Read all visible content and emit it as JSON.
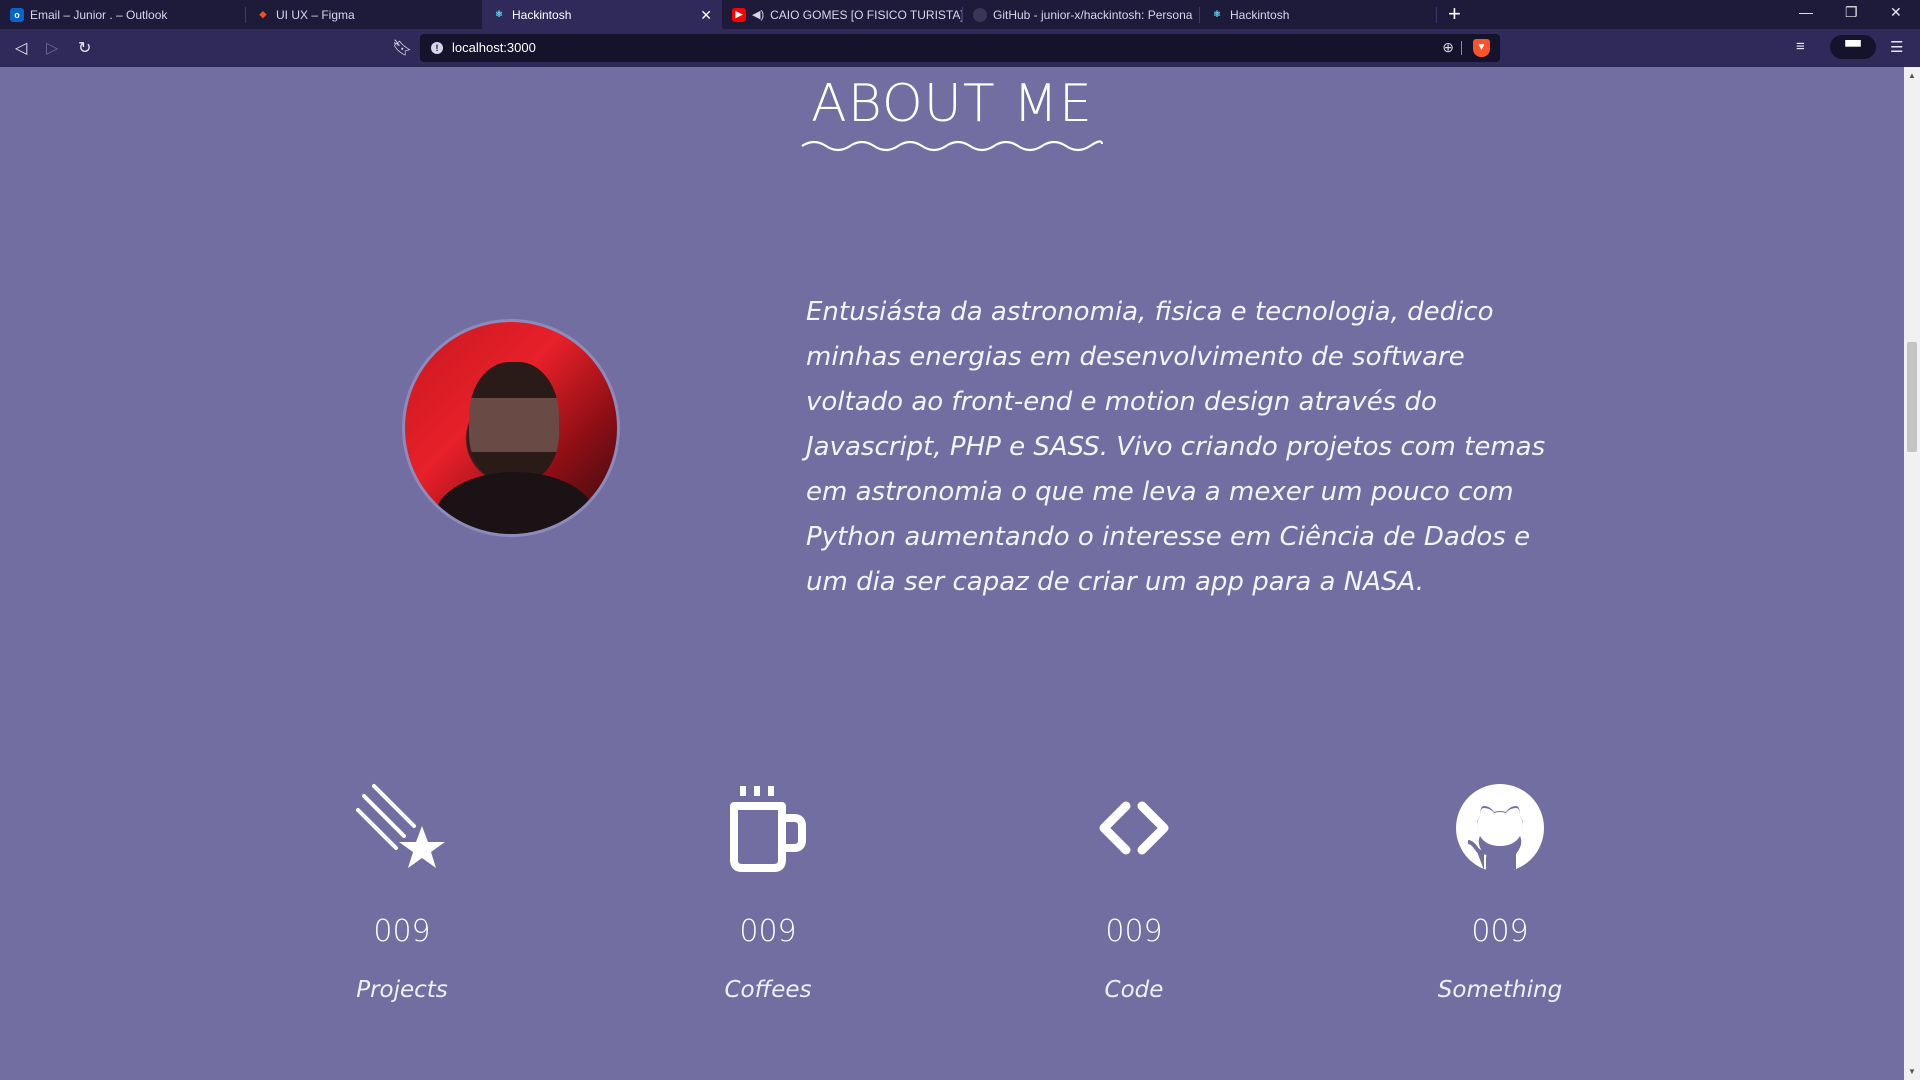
{
  "browser": {
    "tabs": [
      {
        "title": "Email – Junior . – Outlook",
        "favicon": "outlook-icon",
        "color": "#0a64c8"
      },
      {
        "title": "UI UX – Figma",
        "favicon": "figma-icon",
        "color": "#a259ff"
      },
      {
        "title": "Hackintosh",
        "favicon": "react-icon",
        "color": "#61dafb"
      },
      {
        "title": "CAIO GOMES [O FISICO TURISTA]",
        "favicon": "youtube-icon",
        "color": "#ff0000"
      },
      {
        "title": "GitHub - junior-x/hackintosh: Persona",
        "favicon": "github-icon",
        "color": "#333333"
      },
      {
        "title": "Hackintosh",
        "favicon": "react-icon",
        "color": "#61dafb"
      }
    ],
    "url": "localhost:3000"
  },
  "page": {
    "title": "ABOUT ME",
    "bio": "Entusiásta da astronomia, fisica e tecnologia, dedico minhas energias em desenvolvimento de software voltado ao front-end e motion design através do Javascript, PHP e SASS. Vivo criando projetos com temas em astronomia o que me leva a mexer um pouco com Python aumentando o interesse em Ciência de Dados e um dia ser capaz de criar um app para a NASA.",
    "stats": [
      {
        "icon": "shooting-star-icon",
        "value": "009",
        "label": "Projects"
      },
      {
        "icon": "coffee-mug-icon",
        "value": "009",
        "label": "Coffees"
      },
      {
        "icon": "code-brackets-icon",
        "value": "009",
        "label": "Code"
      },
      {
        "icon": "github-icon",
        "value": "009",
        "label": "Something"
      }
    ]
  },
  "colors": {
    "page_background": "#726ea1",
    "chrome_background": "#2f2a5a",
    "text": "#ffffff"
  }
}
